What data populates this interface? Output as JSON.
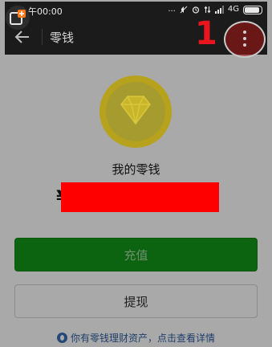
{
  "status_bar": {
    "time": "上午00:00",
    "more_indicator": "...",
    "network_label": "4G"
  },
  "app_bar": {
    "title": "零钱",
    "more_menu_icon": "more-vertical-icon"
  },
  "annotation": {
    "step_number": "1",
    "highlight_color": "#aa1414",
    "number_color": "#e8141e"
  },
  "wallet": {
    "icon": "diamond-icon",
    "label": "我的零钱",
    "currency_symbol": "¥",
    "redaction_color": "#ff0000"
  },
  "actions": {
    "recharge_label": "充值",
    "withdraw_label": "提现",
    "recharge_color": "#0c6410"
  },
  "footer": {
    "link_text": "你有零钱理财资产，点击查看详情",
    "icon": "licaitong-icon"
  },
  "colors": {
    "app_bar": "#1b1b1b",
    "dimmed_background": "#a9a9a9"
  }
}
